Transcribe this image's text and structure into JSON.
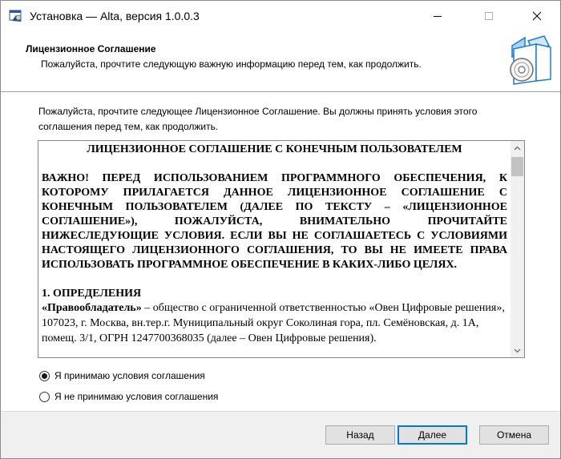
{
  "window": {
    "title": "Установка — Alta, версия 1.0.0.3",
    "controls": {
      "minimize": "—",
      "maximize": "☐",
      "close": "✕"
    }
  },
  "header": {
    "title": "Лицензионное Соглашение",
    "subtitle": "Пожалуйста, прочтите следующую важную информацию перед тем, как продолжить."
  },
  "intro_text": "Пожалуйста, прочтите следующее Лицензионное Соглашение. Вы должны принять условия этого соглашения перед тем, как продолжить.",
  "license": {
    "title": "ЛИЦЕНЗИОННОЕ СОГЛАШЕНИЕ С КОНЕЧНЫМ ПОЛЬЗОВАТЕЛЕМ",
    "important": "ВАЖНО! ПЕРЕД ИСПОЛЬЗОВАНИЕМ ПРОГРАММНОГО ОБЕСПЕЧЕНИЯ, К КОТОРОМУ ПРИЛАГАЕТСЯ ДАННОЕ ЛИЦЕНЗИОННОЕ СОГЛАШЕНИЕ С КОНЕЧНЫМ ПОЛЬЗОВАТЕЛЕМ (ДАЛЕЕ ПО ТЕКСТУ – «ЛИЦЕНЗИОННОЕ СОГЛАШЕНИЕ»), ПОЖАЛУЙСТА, ВНИМАТЕЛЬНО ПРОЧИТАЙТЕ НИЖЕСЛЕДУЮЩИЕ УСЛОВИЯ. ЕСЛИ ВЫ НЕ СОГЛАШАЕТЕСЬ С УСЛОВИЯМИ НАСТОЯЩЕГО ЛИЦЕНЗИОННОГО СОГЛАШЕНИЯ, ТО ВЫ НЕ ИМЕЕТЕ ПРАВА ИСПОЛЬЗОВАТЬ ПРОГРАММНОЕ ОБЕСПЕЧЕНИЕ В КАКИХ-ЛИБО ЦЕЛЯХ.",
    "section_heading": "1. ОПРЕДЕЛЕНИЯ",
    "term": "«Правообладатель»",
    "definition": " – общество с ограниченной ответственностью «Овен Цифровые решения», 107023, г. Москва, вн.тер.г. Муниципальный округ Соколиная гора, пл. Семёновская, д. 1А, помещ. 3/1, ОГРН 1247700368035 (далее – Овен Цифровые решения)."
  },
  "radio": {
    "accept": "Я принимаю условия соглашения",
    "decline": "Я не принимаю условия соглашения",
    "selected": "accept"
  },
  "buttons": {
    "back": "Назад",
    "next": "Далее",
    "cancel": "Отмена"
  },
  "icons": {
    "app": "installer-icon",
    "wizard": "box-with-disc-icon"
  }
}
